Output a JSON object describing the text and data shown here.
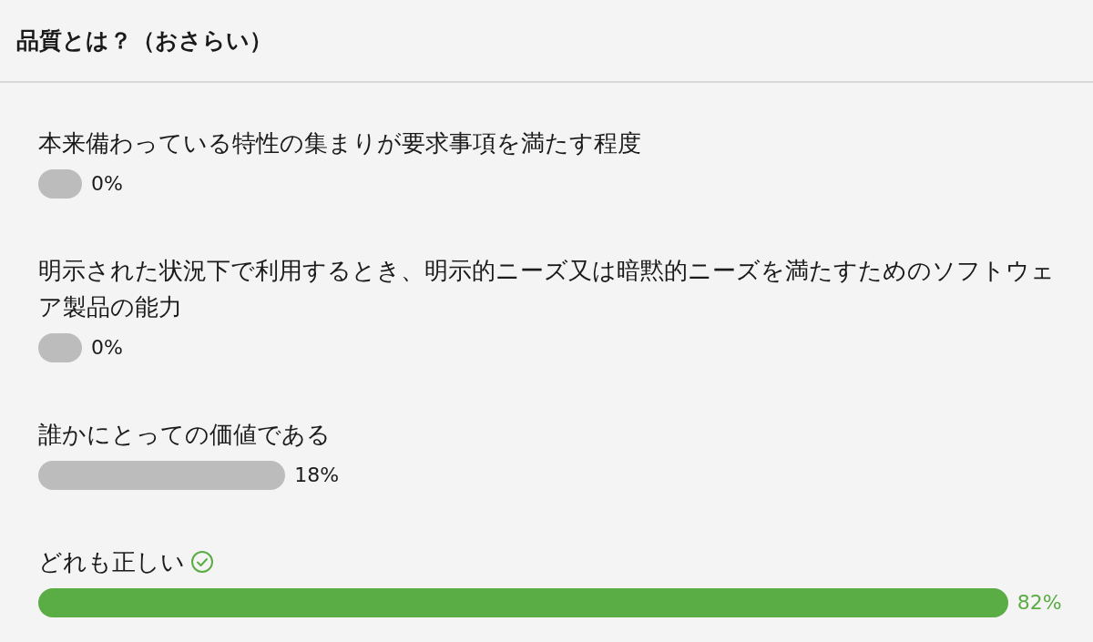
{
  "title": "品質とは？（おさらい）",
  "options": [
    {
      "label": "本来備わっている特性の集まりが要求事項を満たす程度",
      "percent": "0%",
      "correct": false
    },
    {
      "label": "明示された状況下で利用するとき、明示的ニーズ又は暗黙的ニーズを満たすためのソフトウェア製品の能力",
      "percent": "0%",
      "correct": false
    },
    {
      "label": "誰かにとっての価値である",
      "percent": "18%",
      "correct": false
    },
    {
      "label": "どれも正しい",
      "percent": "82%",
      "correct": true
    }
  ]
}
